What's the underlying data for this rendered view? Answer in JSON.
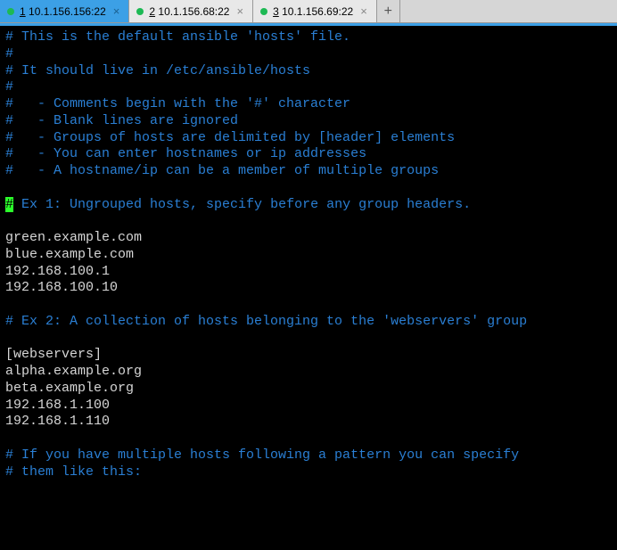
{
  "tabs": {
    "items": [
      {
        "num": "1",
        "label": "10.1.156.156:22",
        "active": true,
        "dot": "green"
      },
      {
        "num": "2",
        "label": "10.1.156.68:22",
        "active": false,
        "dot": "green"
      },
      {
        "num": "3",
        "label": "10.1.156.69:22",
        "active": false,
        "dot": "green"
      }
    ],
    "close_glyph": "×",
    "add_glyph": "+"
  },
  "terminal": {
    "lines": [
      {
        "style": "c",
        "text": "# This is the default ansible 'hosts' file."
      },
      {
        "style": "c",
        "text": "#"
      },
      {
        "style": "c",
        "text": "# It should live in /etc/ansible/hosts"
      },
      {
        "style": "c",
        "text": "#"
      },
      {
        "style": "c",
        "text": "#   - Comments begin with the '#' character"
      },
      {
        "style": "c",
        "text": "#   - Blank lines are ignored"
      },
      {
        "style": "c",
        "text": "#   - Groups of hosts are delimited by [header] elements"
      },
      {
        "style": "c",
        "text": "#   - You can enter hostnames or ip addresses"
      },
      {
        "style": "c",
        "text": "#   - A hostname/ip can be a member of multiple groups"
      },
      {
        "style": "p",
        "text": ""
      },
      {
        "style": "c",
        "text": " Ex 1: Ungrouped hosts, specify before any group headers.",
        "cursor": "#"
      },
      {
        "style": "p",
        "text": ""
      },
      {
        "style": "p",
        "text": "green.example.com"
      },
      {
        "style": "p",
        "text": "blue.example.com"
      },
      {
        "style": "p",
        "text": "192.168.100.1"
      },
      {
        "style": "p",
        "text": "192.168.100.10"
      },
      {
        "style": "p",
        "text": ""
      },
      {
        "style": "c",
        "text": "# Ex 2: A collection of hosts belonging to the 'webservers' group"
      },
      {
        "style": "p",
        "text": ""
      },
      {
        "style": "p",
        "text": "[webservers]"
      },
      {
        "style": "p",
        "text": "alpha.example.org"
      },
      {
        "style": "p",
        "text": "beta.example.org"
      },
      {
        "style": "p",
        "text": "192.168.1.100"
      },
      {
        "style": "p",
        "text": "192.168.1.110"
      },
      {
        "style": "p",
        "text": ""
      },
      {
        "style": "c",
        "text": "# If you have multiple hosts following a pattern you can specify"
      },
      {
        "style": "c",
        "text": "# them like this:"
      }
    ]
  }
}
